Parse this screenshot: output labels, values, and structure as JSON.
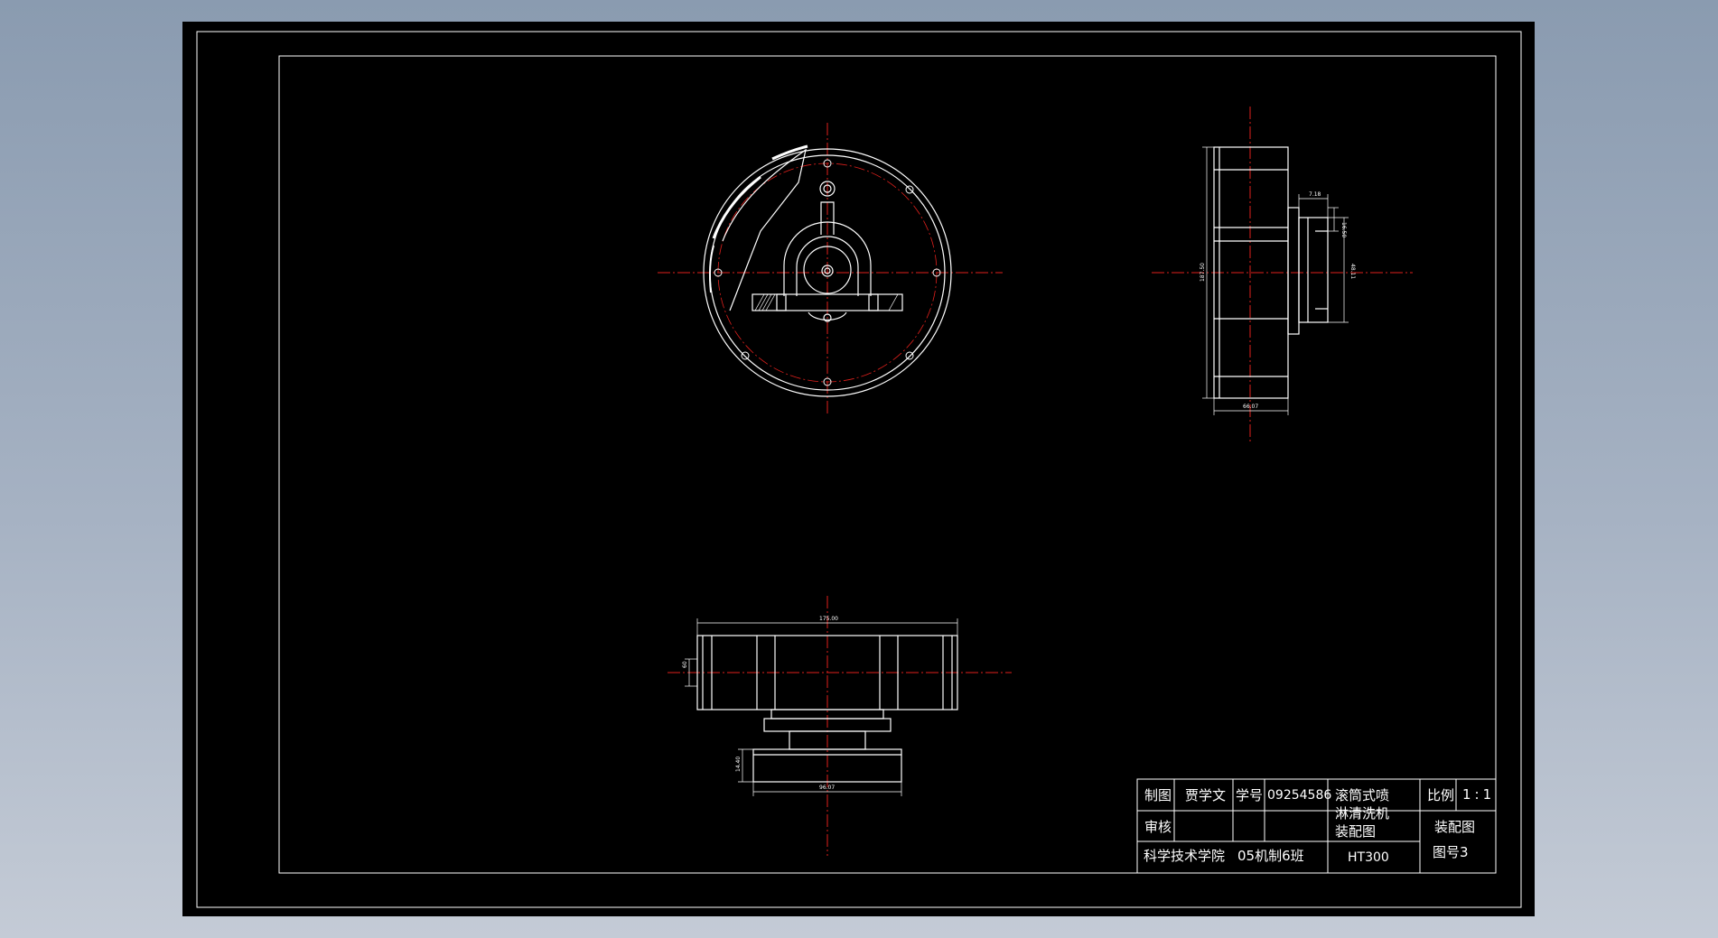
{
  "title_block": {
    "drawn_label": "制图",
    "drawer_name": "贾学文",
    "student_id_label": "学号",
    "student_id": "09254586",
    "review_label": "审核",
    "product_name_line1": "滚筒式喷",
    "product_name_line2": "淋清洗机",
    "product_name_line3": "装配图",
    "scale_label": "比例",
    "scale_value": "1:1",
    "drawing_type": "装配图",
    "drawing_number": "图号3",
    "school": "科学技术学院",
    "class_name": "05机制6班",
    "material": "HT300"
  },
  "dimensions": {
    "side_top_width": "7.18",
    "side_right_small": "16.50",
    "side_right_hub": "48.11",
    "side_left_height": "187.50",
    "side_bottom_width": "66.07",
    "bottom_top_width": "175.00",
    "bottom_left_height": "60",
    "bottom_small_left": "14.40",
    "bottom_bottom_width": "96.07"
  },
  "colors": {
    "line": "#ffffff",
    "center_line": "#e0201c",
    "sheet": "#000000"
  }
}
